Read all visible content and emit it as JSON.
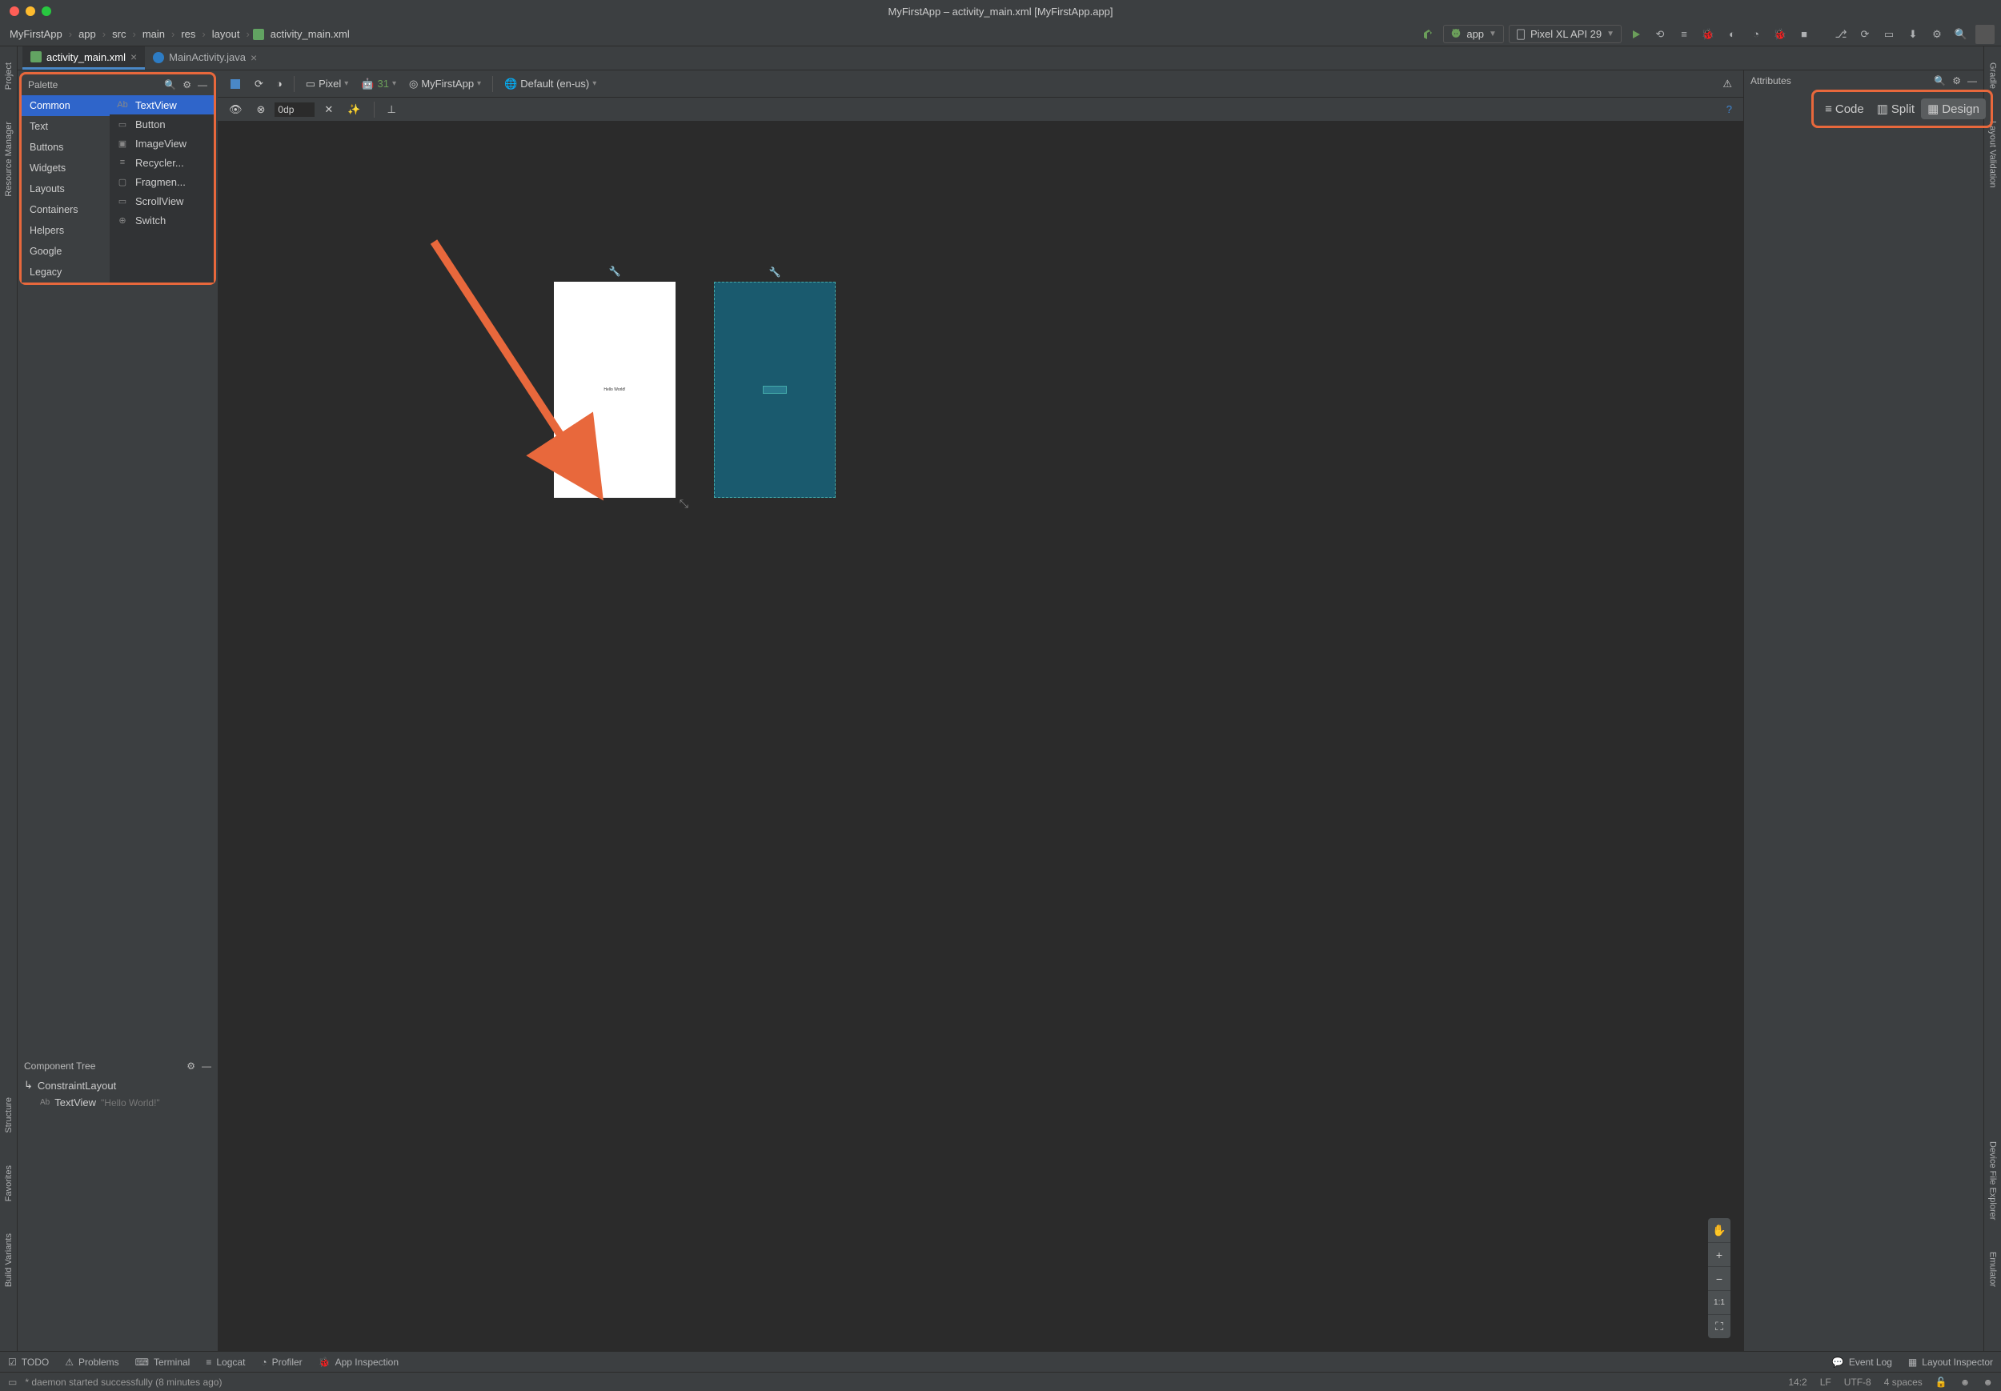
{
  "window": {
    "title": "MyFirstApp – activity_main.xml [MyFirstApp.app]"
  },
  "breadcrumbs": [
    "MyFirstApp",
    "app",
    "src",
    "main",
    "res",
    "layout",
    "activity_main.xml"
  ],
  "run_config": "app",
  "device_select": "Pixel XL API 29",
  "tabs": [
    {
      "label": "activity_main.xml",
      "active": true,
      "type": "xml"
    },
    {
      "label": "MainActivity.java",
      "active": false,
      "type": "java"
    }
  ],
  "left_rail": [
    "Project",
    "Resource Manager",
    "Structure",
    "Favorites",
    "Build Variants"
  ],
  "right_rail": [
    "Gradle",
    "Layout Validation",
    "Device File Explorer",
    "Emulator"
  ],
  "view_modes": {
    "code": "Code",
    "split": "Split",
    "design": "Design",
    "active": "design"
  },
  "palette": {
    "title": "Palette",
    "categories": [
      "Common",
      "Text",
      "Buttons",
      "Widgets",
      "Layouts",
      "Containers",
      "Helpers",
      "Google",
      "Legacy"
    ],
    "selected_cat": "Common",
    "items": [
      {
        "icon": "Ab",
        "label": "TextView",
        "sel": true
      },
      {
        "icon": "▭",
        "label": "Button"
      },
      {
        "icon": "▣",
        "label": "ImageView"
      },
      {
        "icon": "≡",
        "label": "Recycler..."
      },
      {
        "icon": "▢",
        "label": "Fragmen..."
      },
      {
        "icon": "▭",
        "label": "ScrollView"
      },
      {
        "icon": "⊕",
        "label": "Switch"
      }
    ]
  },
  "component_tree": {
    "title": "Component Tree",
    "root": {
      "label": "ConstraintLayout"
    },
    "child": {
      "label": "TextView",
      "hint": "\"Hello World!\""
    }
  },
  "design_toolbar": {
    "device": "Pixel",
    "api": "31",
    "theme": "MyFirstApp",
    "locale": "Default (en-us)"
  },
  "toolbar2": {
    "margin": "0dp"
  },
  "attributes": {
    "title": "Attributes"
  },
  "preview_text": "Hello World!",
  "bottom_tabs_left": [
    "TODO",
    "Problems",
    "Terminal",
    "Logcat",
    "Profiler",
    "App Inspection"
  ],
  "bottom_tabs_right": [
    "Event Log",
    "Layout Inspector"
  ],
  "status": {
    "msg": "* daemon started successfully (8 minutes ago)",
    "pos": "14:2",
    "le": "LF",
    "enc": "UTF-8",
    "indent": "4 spaces"
  },
  "colors": {
    "highlight": "#e8683c"
  }
}
